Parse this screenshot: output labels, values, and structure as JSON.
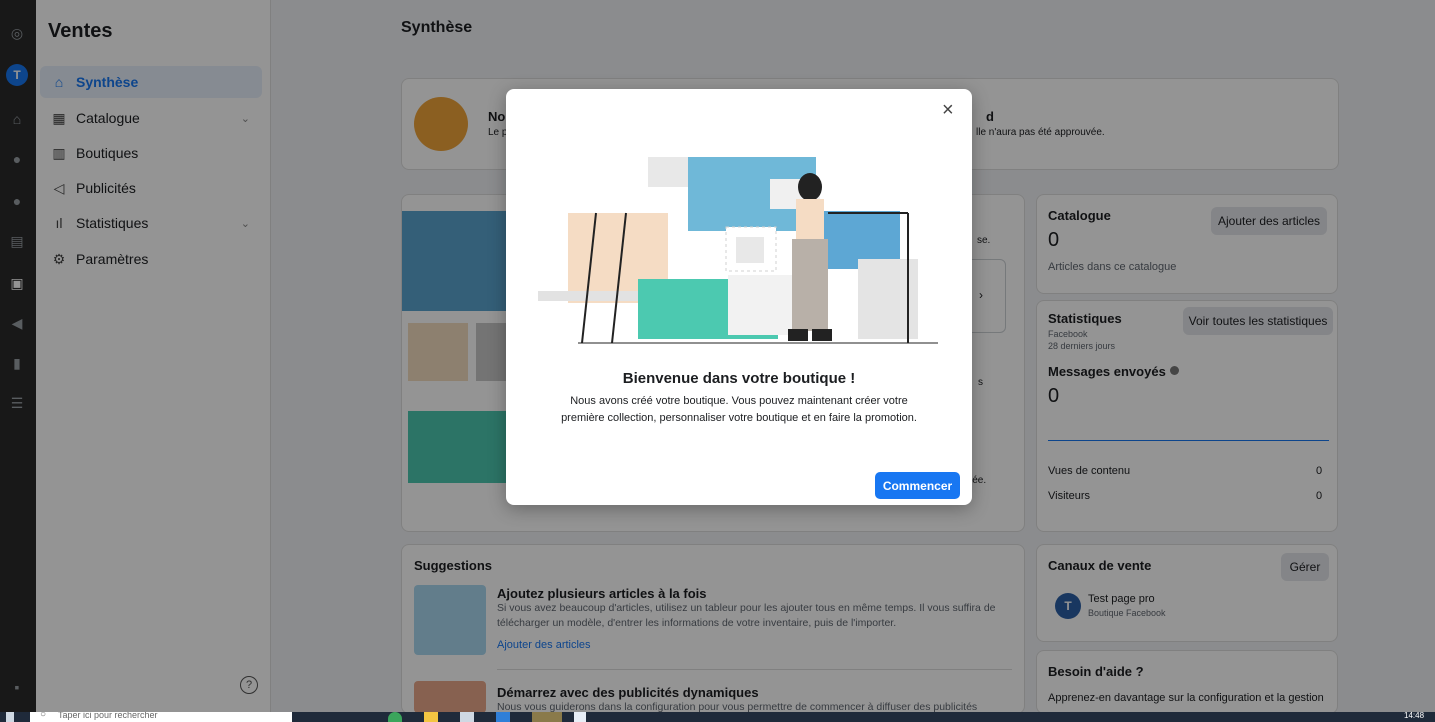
{
  "rail": {
    "avatar": "T"
  },
  "sidebar": {
    "title": "Ventes",
    "items": [
      {
        "label": "Synthèse"
      },
      {
        "label": "Catalogue"
      },
      {
        "label": "Boutiques"
      },
      {
        "label": "Publicités"
      },
      {
        "label": "Statistiques"
      },
      {
        "label": "Paramètres"
      }
    ]
  },
  "main": {
    "page_title": "Synthèse",
    "notice": {
      "title_start": "No",
      "title_end": "d",
      "text_start": "Le p",
      "text_end": "lle n'aura pas été approuvée."
    },
    "setup_peek": {
      "t1": "se.",
      "t2": "s",
      "t3": "iée."
    },
    "catalogue": {
      "title": "Catalogue",
      "button": "Ajouter des articles",
      "count": "0",
      "subtitle": "Articles dans ce catalogue"
    },
    "stats": {
      "title": "Statistiques",
      "button": "Voir toutes les statistiques",
      "source": "Facebook",
      "period": "28 derniers jours",
      "metric_label": "Messages envoyés",
      "metric_value": "0",
      "rows": [
        {
          "label": "Vues de contenu",
          "value": "0"
        },
        {
          "label": "Visiteurs",
          "value": "0"
        }
      ]
    },
    "suggestions": {
      "title": "Suggestions",
      "items": [
        {
          "title": "Ajoutez plusieurs articles à la fois",
          "desc1": "Si vous avez beaucoup d'articles, utilisez un tableur pour les ajouter tous en même temps. Il vous suffira de",
          "desc2": "télécharger un modèle, d'entrer les informations de votre inventaire, puis de l'importer.",
          "link": "Ajouter des articles"
        },
        {
          "title": "Démarrez avec des publicités dynamiques",
          "desc1": "Nous vous guiderons dans la configuration pour vous permettre de commencer à diffuser des publicités"
        }
      ]
    },
    "channels": {
      "title": "Canaux de vente",
      "button": "Gérer",
      "page_name": "Test page pro",
      "page_type": "Boutique Facebook"
    },
    "help": {
      "title": "Besoin d'aide ?",
      "text": "Apprenez-en davantage sur la configuration et la gestion"
    }
  },
  "modal": {
    "title": "Bienvenue dans votre boutique !",
    "body": "Nous avons créé votre boutique. Vous pouvez maintenant créer votre première collection, personnaliser votre boutique et en faire la promotion.",
    "button": "Commencer",
    "close": "×"
  },
  "taskbar": {
    "search_placeholder": "Taper ici pour rechercher",
    "time": "14:48"
  },
  "colors": {
    "accent": "#1877f2",
    "overlay": "rgba(0,0,0,0.42)",
    "teal": "#4cc9b0",
    "tan": "#f3dcc0"
  }
}
